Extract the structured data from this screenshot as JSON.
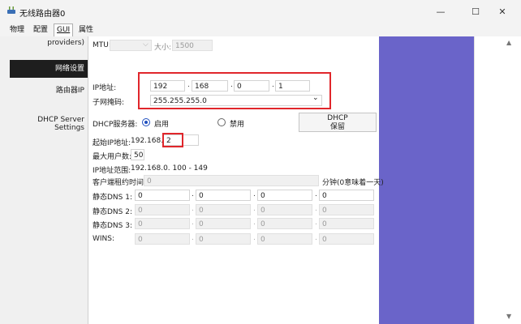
{
  "window": {
    "title": "无线路由器0",
    "minimize_glyph": "—",
    "maximize_glyph": "☐",
    "close_glyph": "✕"
  },
  "tabs": [
    "物理",
    "配置",
    "GUI",
    "属性"
  ],
  "active_tab": "GUI",
  "left": {
    "providers_text": "providers)",
    "section_network": "网络设置",
    "router_ip": "路由器IP",
    "dhcp_server_settings_line1": "DHCP Server",
    "dhcp_server_settings_line2": "Settings"
  },
  "mtu": {
    "label": "MTU:",
    "arrow": "⌵",
    "size_label": "大小:",
    "size_value": "1500"
  },
  "router_ip": {
    "label": "IP地址:",
    "octets": [
      "192",
      "168",
      "0",
      "1"
    ],
    "separator": ".",
    "mask_label": "子网掩码:",
    "mask_value": "255.255.255.0",
    "mask_arrow": "⌄"
  },
  "dhcp": {
    "server_label": "DHCP服务器:",
    "enabled_label": "启用",
    "disabled_label": "禁用",
    "enabled": true,
    "pool_button_line1": "DHCP",
    "pool_button_line2": "保留",
    "start_ip_label": "起始IP地址:",
    "start_ip_prefix": "192.168.0.",
    "start_ip_last": "2",
    "max_users_label": "最大用户数:",
    "max_users_value": "50",
    "range_label": "IP地址范围:",
    "range_value": "192.168.0. 100 - 149",
    "lease_label": "客户端租约时间:",
    "lease_value": "0",
    "lease_unit": "分钟(0意味着一天)"
  },
  "dns": [
    {
      "label": "静态DNS 1:",
      "octets": [
        "0",
        "0",
        "0",
        "0"
      ],
      "disabled": false
    },
    {
      "label": "静态DNS 2:",
      "octets": [
        "0",
        "0",
        "0",
        "0"
      ],
      "disabled": true
    },
    {
      "label": "静态DNS 3:",
      "octets": [
        "0",
        "0",
        "0",
        "0"
      ],
      "disabled": true
    },
    {
      "label": "WINS:",
      "octets": [
        "0",
        "0",
        "0",
        "0"
      ],
      "disabled": true
    }
  ],
  "colors": {
    "highlight_red": "#e0262b",
    "side_blue": "#6a64c9",
    "radio_blue": "#1f4fbf",
    "section_header_bg": "#1e1e1e"
  },
  "icons": {
    "app": "router-app-icon",
    "radio_on": "radio-selected-icon",
    "radio_off": "radio-unselected-icon"
  }
}
